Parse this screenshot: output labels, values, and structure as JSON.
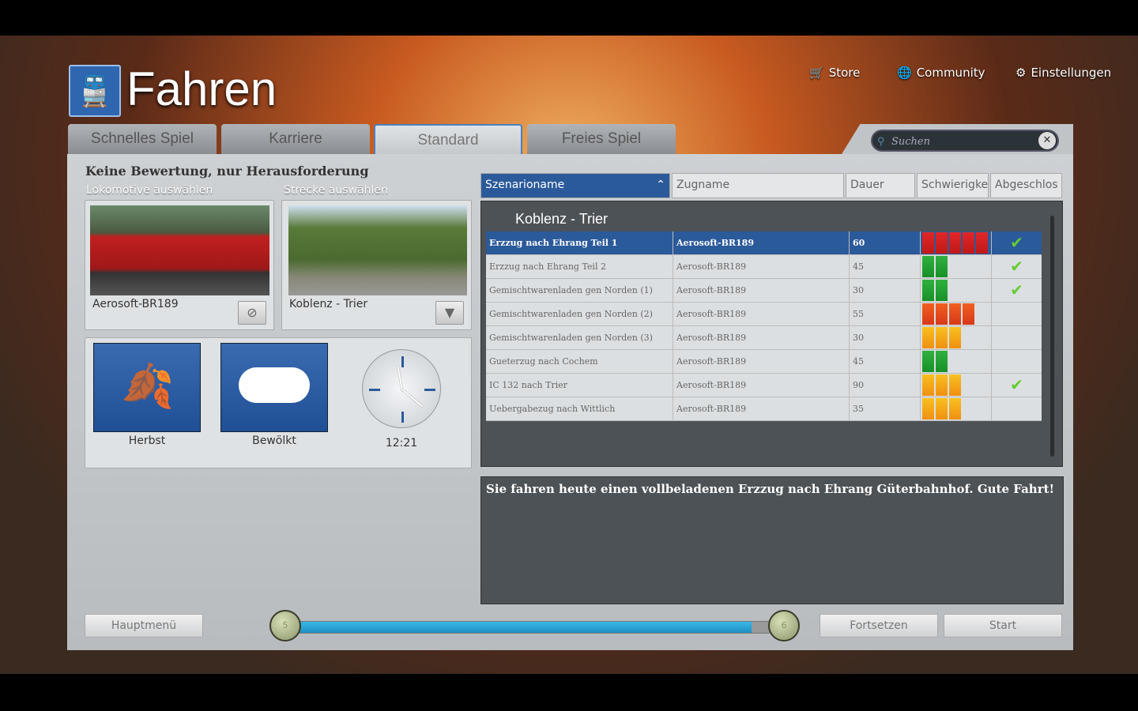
{
  "header": {
    "title": "Fahren",
    "store": "Store",
    "community": "Community",
    "settings": "Einstellungen"
  },
  "tabs": [
    "Schnelles Spiel",
    "Karriere",
    "Standard",
    "Freies Spiel"
  ],
  "search": {
    "placeholder": "Suchen"
  },
  "left": {
    "heading": "Keine Bewertung, nur Herausforderung",
    "loco_label": "Lokomotive auswählen",
    "route_label": "Strecke auswählen",
    "loco": "Aerosoft-BR189",
    "route": "Koblenz - Trier",
    "season": "Herbst",
    "weather": "Bewölkt",
    "time": "12:21"
  },
  "columns": [
    "Szenarioname",
    "Zugname",
    "Dauer",
    "Schwierigke",
    "Abgeschlos"
  ],
  "group": "Koblenz - Trier",
  "rows": [
    {
      "name": "Erzzug nach Ehrang Teil 1",
      "train": "Aerosoft-BR189",
      "duration": "60",
      "difficulty": 5,
      "done": true
    },
    {
      "name": "Erzzug nach Ehrang Teil 2",
      "train": "Aerosoft-BR189",
      "duration": "45",
      "difficulty": 2,
      "done": true
    },
    {
      "name": "Gemischtwarenladen gen Norden (1)",
      "train": "Aerosoft-BR189",
      "duration": "30",
      "difficulty": 2,
      "done": true
    },
    {
      "name": "Gemischtwarenladen gen Norden (2)",
      "train": "Aerosoft-BR189",
      "duration": "55",
      "difficulty": 4,
      "done": false
    },
    {
      "name": "Gemischtwarenladen gen Norden (3)",
      "train": "Aerosoft-BR189",
      "duration": "30",
      "difficulty": 3,
      "done": false
    },
    {
      "name": "Gueterzug nach Cochem",
      "train": "Aerosoft-BR189",
      "duration": "45",
      "difficulty": 2,
      "done": false
    },
    {
      "name": "IC 132 nach Trier",
      "train": "Aerosoft-BR189",
      "duration": "90",
      "difficulty": 3,
      "done": true
    },
    {
      "name": "Uebergabezug nach Wittlich",
      "train": "Aerosoft-BR189",
      "duration": "35",
      "difficulty": 3,
      "done": false
    }
  ],
  "description": "Sie fahren heute einen vollbeladenen Erzzug nach Ehrang Güterbahnhof. Gute Fahrt!",
  "footer": {
    "main_menu": "Hauptmenü",
    "continue": "Fortsetzen",
    "start": "Start",
    "progress_from": "5",
    "progress_to": "6",
    "progress_percent": 95
  },
  "colors": {
    "selected": "#2b5a9a",
    "progress": "#1e9fd0"
  }
}
